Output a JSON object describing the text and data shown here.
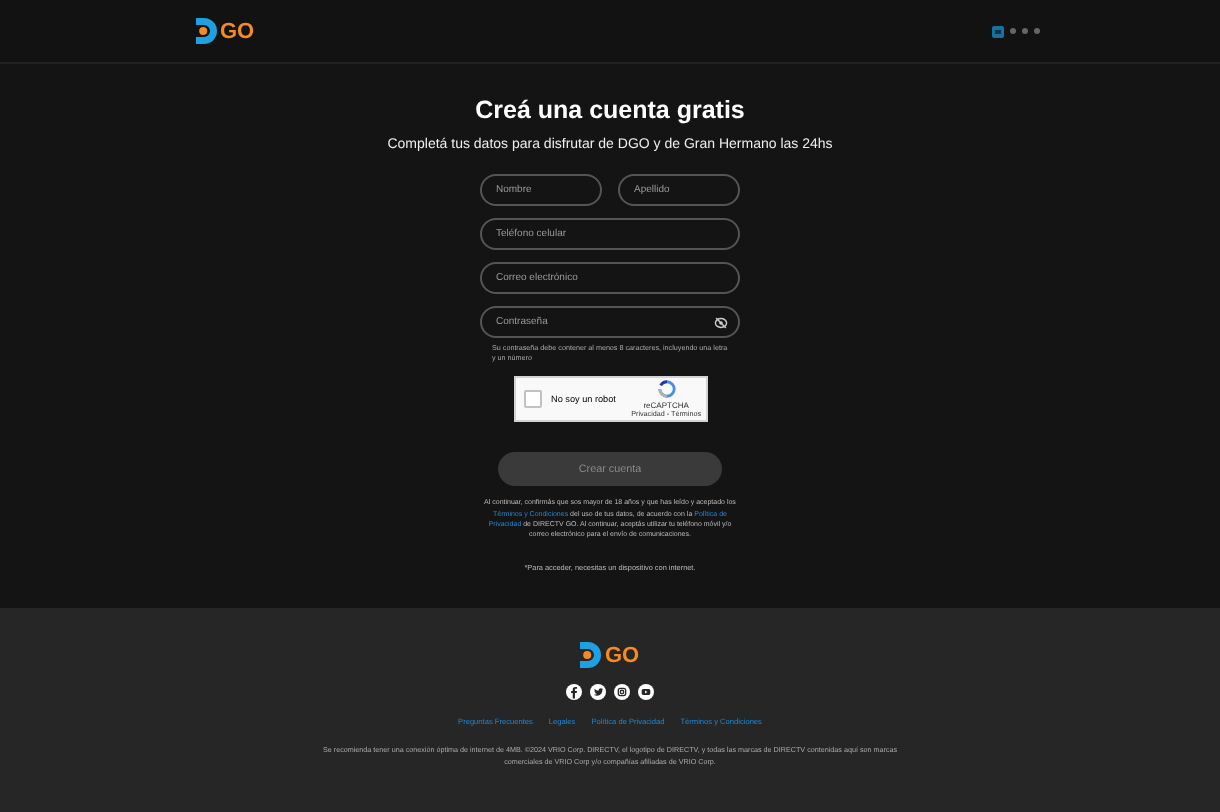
{
  "header": {
    "logo_text": "GO"
  },
  "signup": {
    "title": "Creá una cuenta gratis",
    "subtitle": "Completá tus datos para disfrutar de DGO y de Gran Hermano las 24hs",
    "fields": [
      {
        "kind": "half",
        "placeholder": "Nombre"
      },
      {
        "kind": "half",
        "placeholder": "Apellido"
      },
      {
        "kind": "full",
        "placeholder": "Teléfono celular"
      },
      {
        "kind": "full",
        "placeholder": "Correo electrónico"
      },
      {
        "kind": "password",
        "placeholder": "Contraseña"
      }
    ],
    "password_hint": "Su contraseña debe contener al menos 8 caracteres, incluyendo una letra y un número",
    "captcha": {
      "checked": false,
      "label": "No soy un robot",
      "brand": "reCAPTCHA",
      "links": "Privacidad - Términos"
    },
    "submit": {
      "label": "Crear cuenta",
      "disabled": true
    },
    "consent": "Al continuar, confirmás que sos mayor de 18 años y que has leído y aceptado los **Términos y Condiciones** del uso de tus datos, de acuerdo con la **Política de Privacidad** de DIRECTV GO. Al continuar, aceptás utilizar tu teléfono móvil y/o correo electrónico para el envío de comunicaciones.",
    "note": "*Para acceder, necesitas un dispositivo con internet."
  },
  "footer": {
    "logo_text": "GO",
    "links": [
      "Preguntas Frecuentes",
      "Legales",
      "Política de Privacidad",
      "Términos y Condiciones"
    ],
    "legal": "Se recomienda tener una conexión óptima de internet de 4MB. ©2024 VRIO Corp. DIRECTV, el logotipo de DIRECTV, y todas las marcas de DIRECTV contenidas aquí son marcas comerciales de VRIO Corp y/o compañías afiliadas de VRIO Corp."
  }
}
